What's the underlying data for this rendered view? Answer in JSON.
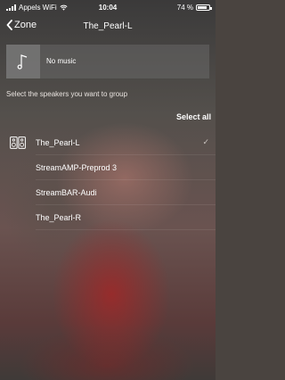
{
  "status_bar": {
    "carrier": "Appels WiFi",
    "time": "10:04",
    "battery": "74 %",
    "battery_level": 0.74
  },
  "nav": {
    "back_label": "Zone",
    "title": "The_Pearl-L"
  },
  "now_playing": {
    "text": "No music",
    "icon": "music-note-icon"
  },
  "group": {
    "instruction": "Select the speakers you want to group",
    "select_all_label": "Select all"
  },
  "speakers": [
    {
      "name": "The_Pearl-L",
      "icon": "speaker-icon",
      "checked": true
    },
    {
      "name": "StreamAMP-Preprod 3",
      "checked": false
    },
    {
      "name": "StreamBAR-Audi",
      "checked": false
    },
    {
      "name": "The_Pearl-R",
      "checked": false
    }
  ],
  "check_glyph": "✓"
}
